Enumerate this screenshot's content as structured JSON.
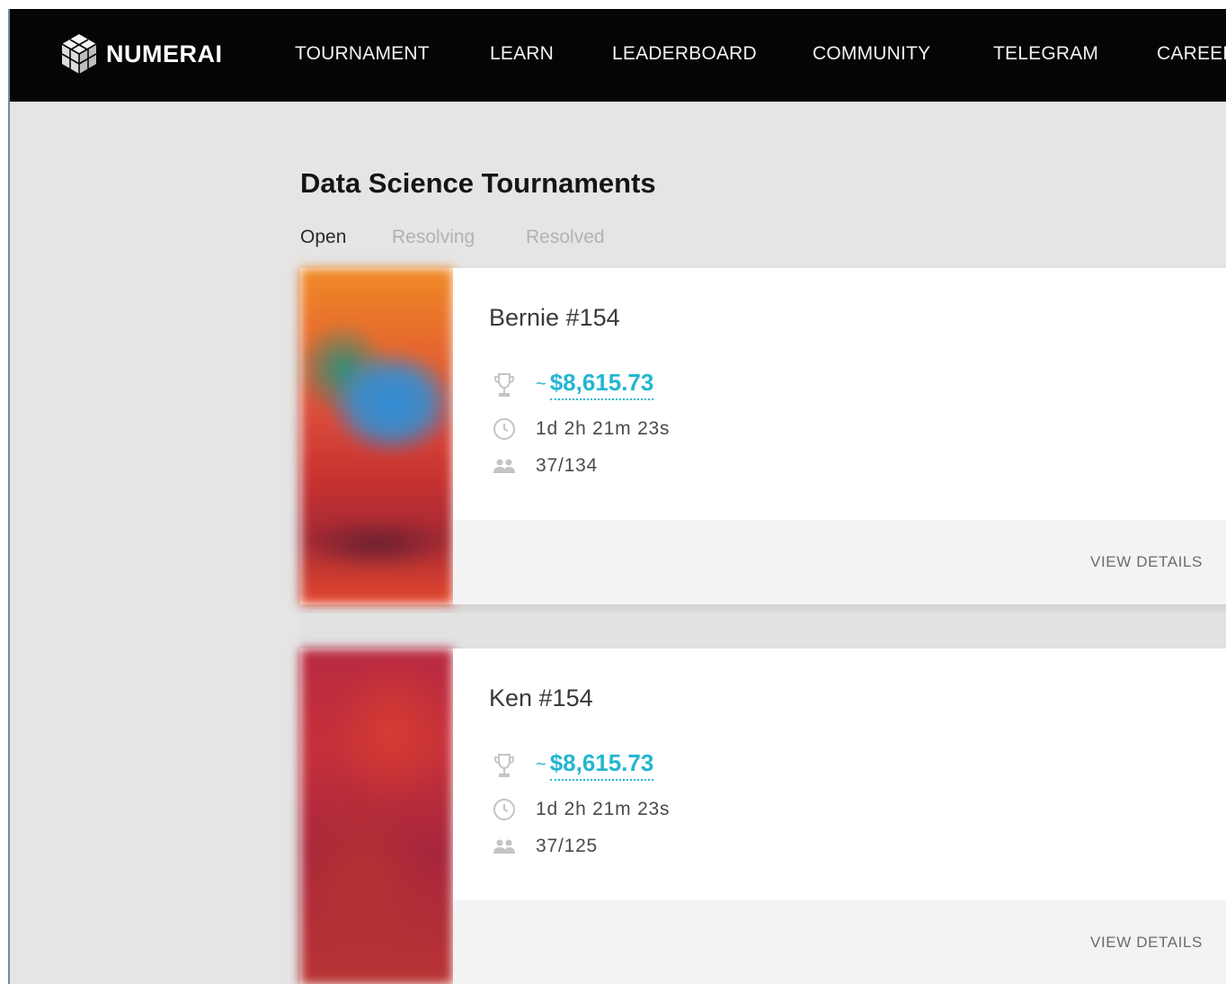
{
  "nav": {
    "brand": "NUMERAI",
    "items": [
      {
        "label": "TOURNAMENT"
      },
      {
        "label": "LEARN"
      },
      {
        "label": "LEADERBOARD"
      },
      {
        "label": "COMMUNITY"
      },
      {
        "label": "TELEGRAM"
      },
      {
        "label": "CAREER"
      }
    ]
  },
  "page": {
    "title": "Data Science Tournaments",
    "tabs": [
      {
        "label": "Open",
        "active": true
      },
      {
        "label": "Resolving",
        "active": false
      },
      {
        "label": "Resolved",
        "active": false
      }
    ]
  },
  "tournaments": [
    {
      "name": "Bernie #154",
      "prize_prefix": "~",
      "prize": "$8,615.73",
      "time_left": "1d 2h 21m 23s",
      "participants": "37/134",
      "action": "VIEW DETAILS",
      "image_icon": "abstract-gradient-orange-blue"
    },
    {
      "name": "Ken #154",
      "prize_prefix": "~",
      "prize": "$8,615.73",
      "time_left": "1d 2h 21m 23s",
      "participants": "37/125",
      "action": "VIEW DETAILS",
      "image_icon": "abstract-gradient-red"
    }
  ],
  "colors": {
    "nav_bg": "#050505",
    "page_bg": "#e5e5e5",
    "accent": "#23b6d1",
    "card_footer_bg": "#f3f3f3"
  }
}
